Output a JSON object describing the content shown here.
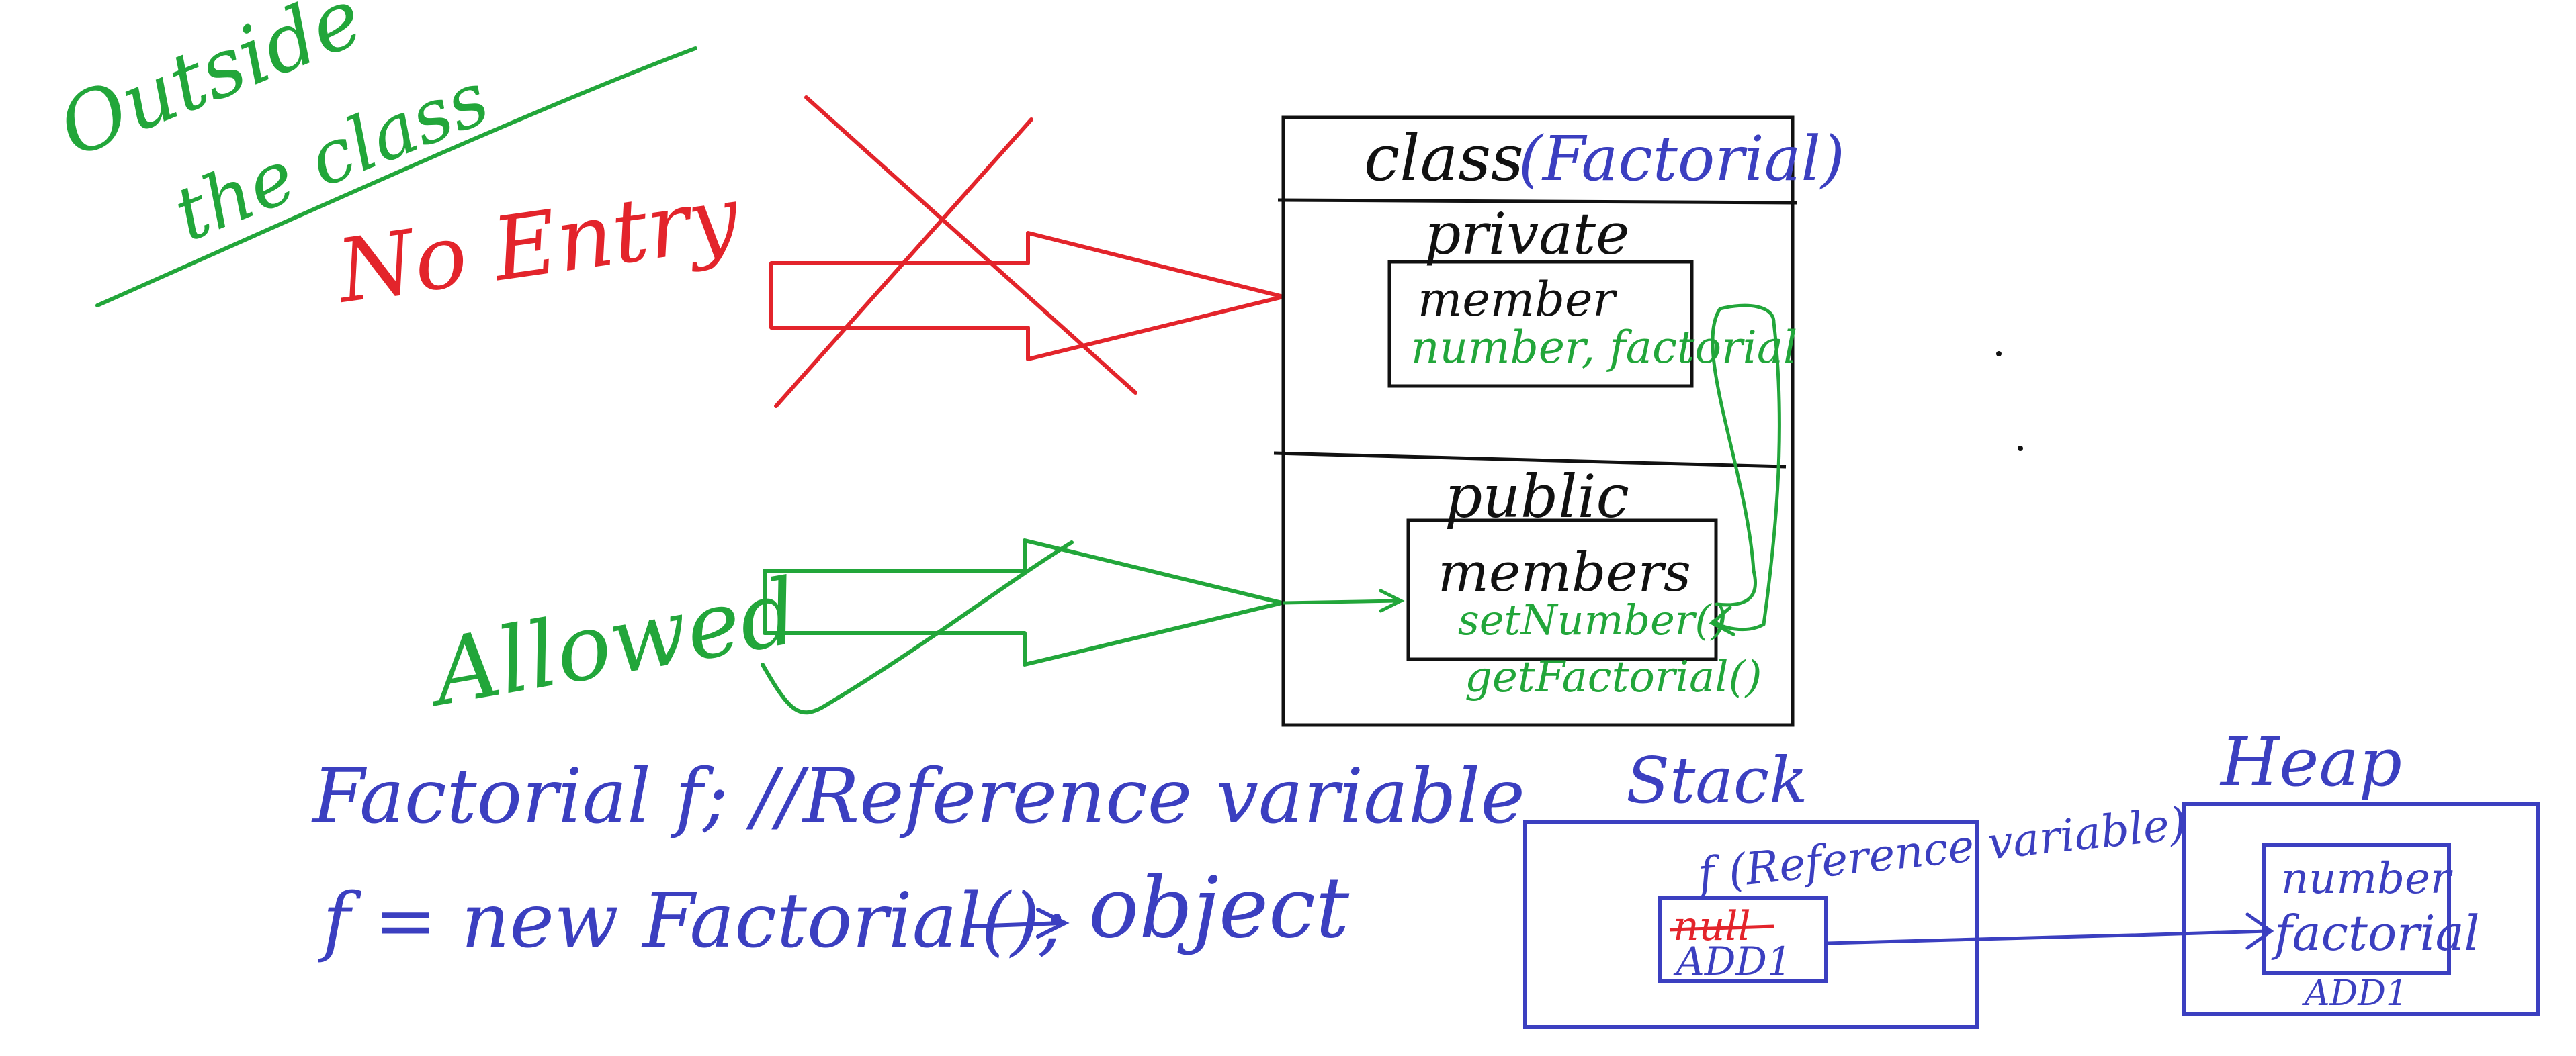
{
  "canvas": {
    "background": "#ffffff"
  },
  "colors": {
    "green": "#22a63a",
    "red": "#e3242b",
    "blue": "#3b3fc0",
    "black": "#111111"
  },
  "outside": {
    "line1": "Outside",
    "line2": "the class"
  },
  "no_entry": "No Entry",
  "allowed": "Allowed",
  "class_box": {
    "title": "class",
    "name": "(Factorial)",
    "private_label": "private",
    "private_members_label": "member",
    "private_members": "number, factorial",
    "public_label": "public",
    "public_members_label": "members",
    "method1": "setNumber()",
    "method2": "getFactorial()"
  },
  "code": {
    "line1": "Factorial f;  //Reference variable",
    "line2": "f = new Factorial();",
    "object_label": "object"
  },
  "stack": {
    "title": "Stack",
    "ref_label": "f (Reference variable)",
    "null_text": "null",
    "address": "ADD1"
  },
  "heap": {
    "title": "Heap",
    "field1": "number",
    "field2": "factorial",
    "address": "ADD1"
  }
}
